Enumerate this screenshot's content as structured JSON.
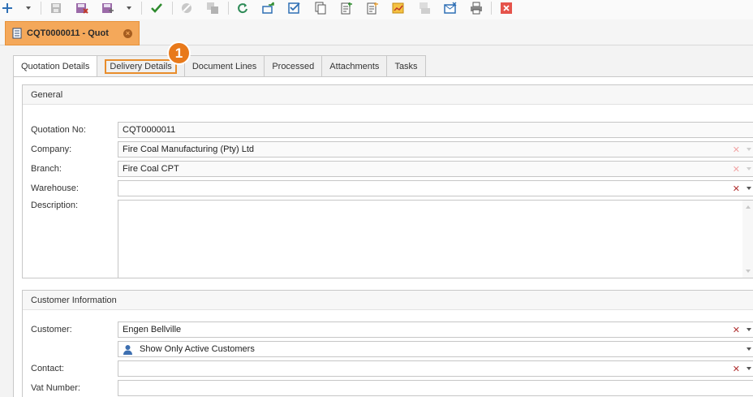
{
  "toolbar": {
    "icons": [
      "add-icon",
      "dropdown-arrow-icon",
      "save-icon",
      "save-close-icon",
      "save-new-icon",
      "dropdown-arrow-icon",
      "approve-check-icon",
      "cancel-icon",
      "copy-icon",
      "refresh-icon",
      "convert-icon",
      "checklist-icon",
      "duplicate-icon",
      "document-add-icon",
      "new-document-icon",
      "chart-export-icon",
      "pdf-email-icon",
      "email-icon",
      "print-icon",
      "close-icon"
    ]
  },
  "document_tab": {
    "title": "CQT0000011 - Quot"
  },
  "tabs": [
    {
      "label": "Quotation Details",
      "active": true
    },
    {
      "label": "Delivery Details",
      "highlighted": true
    },
    {
      "label": "Document Lines"
    },
    {
      "label": "Processed"
    },
    {
      "label": "Attachments"
    },
    {
      "label": "Tasks"
    }
  ],
  "callout": {
    "number": "1"
  },
  "general": {
    "title": "General",
    "quotation_no_label": "Quotation No:",
    "quotation_no": "CQT0000011",
    "company_label": "Company:",
    "company": "Fire Coal Manufacturing (Pty) Ltd",
    "branch_label": "Branch:",
    "branch": "Fire Coal CPT",
    "warehouse_label": "Warehouse:",
    "warehouse": "",
    "description_label": "Description:",
    "description": ""
  },
  "customer_info": {
    "title": "Customer Information",
    "customer_label": "Customer:",
    "customer": "Engen Bellville",
    "filter_option": "Show Only Active Customers",
    "contact_label": "Contact:",
    "contact": "",
    "vat_label": "Vat Number:",
    "vat": ""
  },
  "colors": {
    "accent_tab": "#f4a85a",
    "highlight": "#e88d2c",
    "badge": "#e8791a",
    "clear_x": "#b03030"
  }
}
